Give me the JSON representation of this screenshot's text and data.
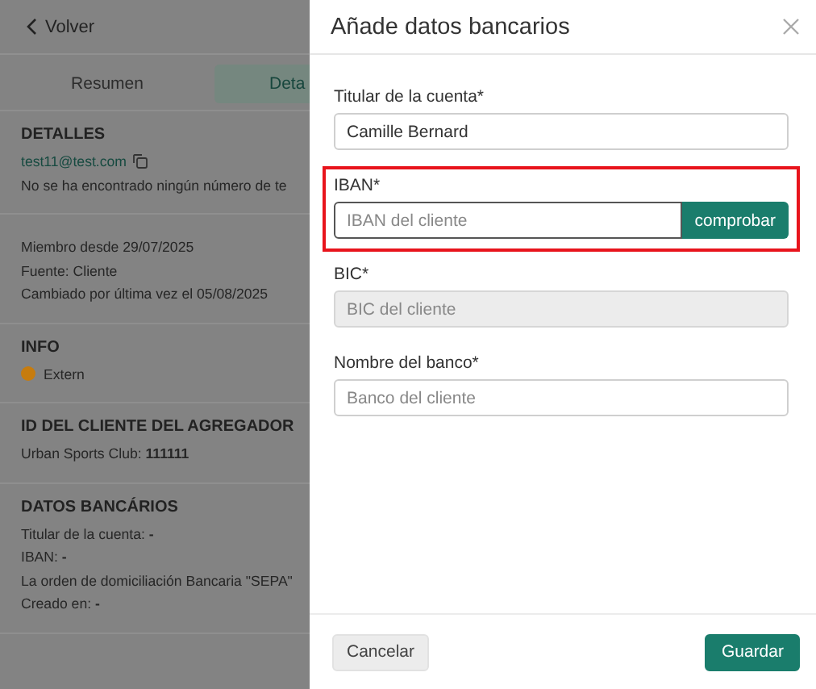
{
  "page": {
    "back_link": "Volver",
    "tabs": [
      {
        "label": "Resumen",
        "selected": false
      },
      {
        "label": "Deta",
        "selected": true
      }
    ],
    "sections": [
      {
        "title": "DETALLES",
        "lines": [
          {
            "kind": "link",
            "text": "test11@test.com"
          },
          {
            "kind": "text",
            "text": "No se ha encontrado ningún número de te"
          }
        ]
      },
      {
        "lines": [
          {
            "kind": "text",
            "text": "Miembro desde 29/07/2025"
          },
          {
            "kind": "text",
            "text": "Fuente: Cliente"
          },
          {
            "kind": "text",
            "text": "Cambiado por última vez el 05/08/2025"
          }
        ]
      },
      {
        "title": "INFO",
        "lines": [
          {
            "kind": "status",
            "text": "Extern",
            "color": "#c77c0e"
          }
        ]
      },
      {
        "title": "ID DEL CLIENTE DEL AGREGADOR",
        "lines": [
          {
            "kind": "text",
            "text": "Urban Sports Club: **111111**"
          }
        ]
      },
      {
        "title": "DATOS BANCÁRIOS",
        "lines": [
          {
            "kind": "text",
            "text": "Titular de la cuenta: **-**"
          },
          {
            "kind": "text",
            "text": "IBAN: **-**"
          },
          {
            "kind": "text",
            "text": "La orden de domiciliación Bancaria \"SEPA\""
          },
          {
            "kind": "text",
            "text": "Creado en: **-**"
          }
        ]
      }
    ]
  },
  "dialog": {
    "title": "Añade datos bancarios",
    "fields": [
      {
        "label": "Titular de la cuenta*",
        "value": "Camille Bernard",
        "disabled": false,
        "highlighted": false
      },
      {
        "label": "IBAN*",
        "placeholder": "IBAN del cliente",
        "disabled": false,
        "highlighted": true,
        "button": "comprobar"
      },
      {
        "label": "BIC*",
        "placeholder": "BIC del cliente",
        "disabled": true,
        "highlighted": false
      },
      {
        "label": "Nombre del banco*",
        "placeholder": "Banco del cliente",
        "disabled": false,
        "highlighted": false
      }
    ],
    "buttons": [
      {
        "kind": "secondary",
        "label": "Cancelar"
      },
      {
        "kind": "primary",
        "label": "Guardar"
      }
    ]
  }
}
